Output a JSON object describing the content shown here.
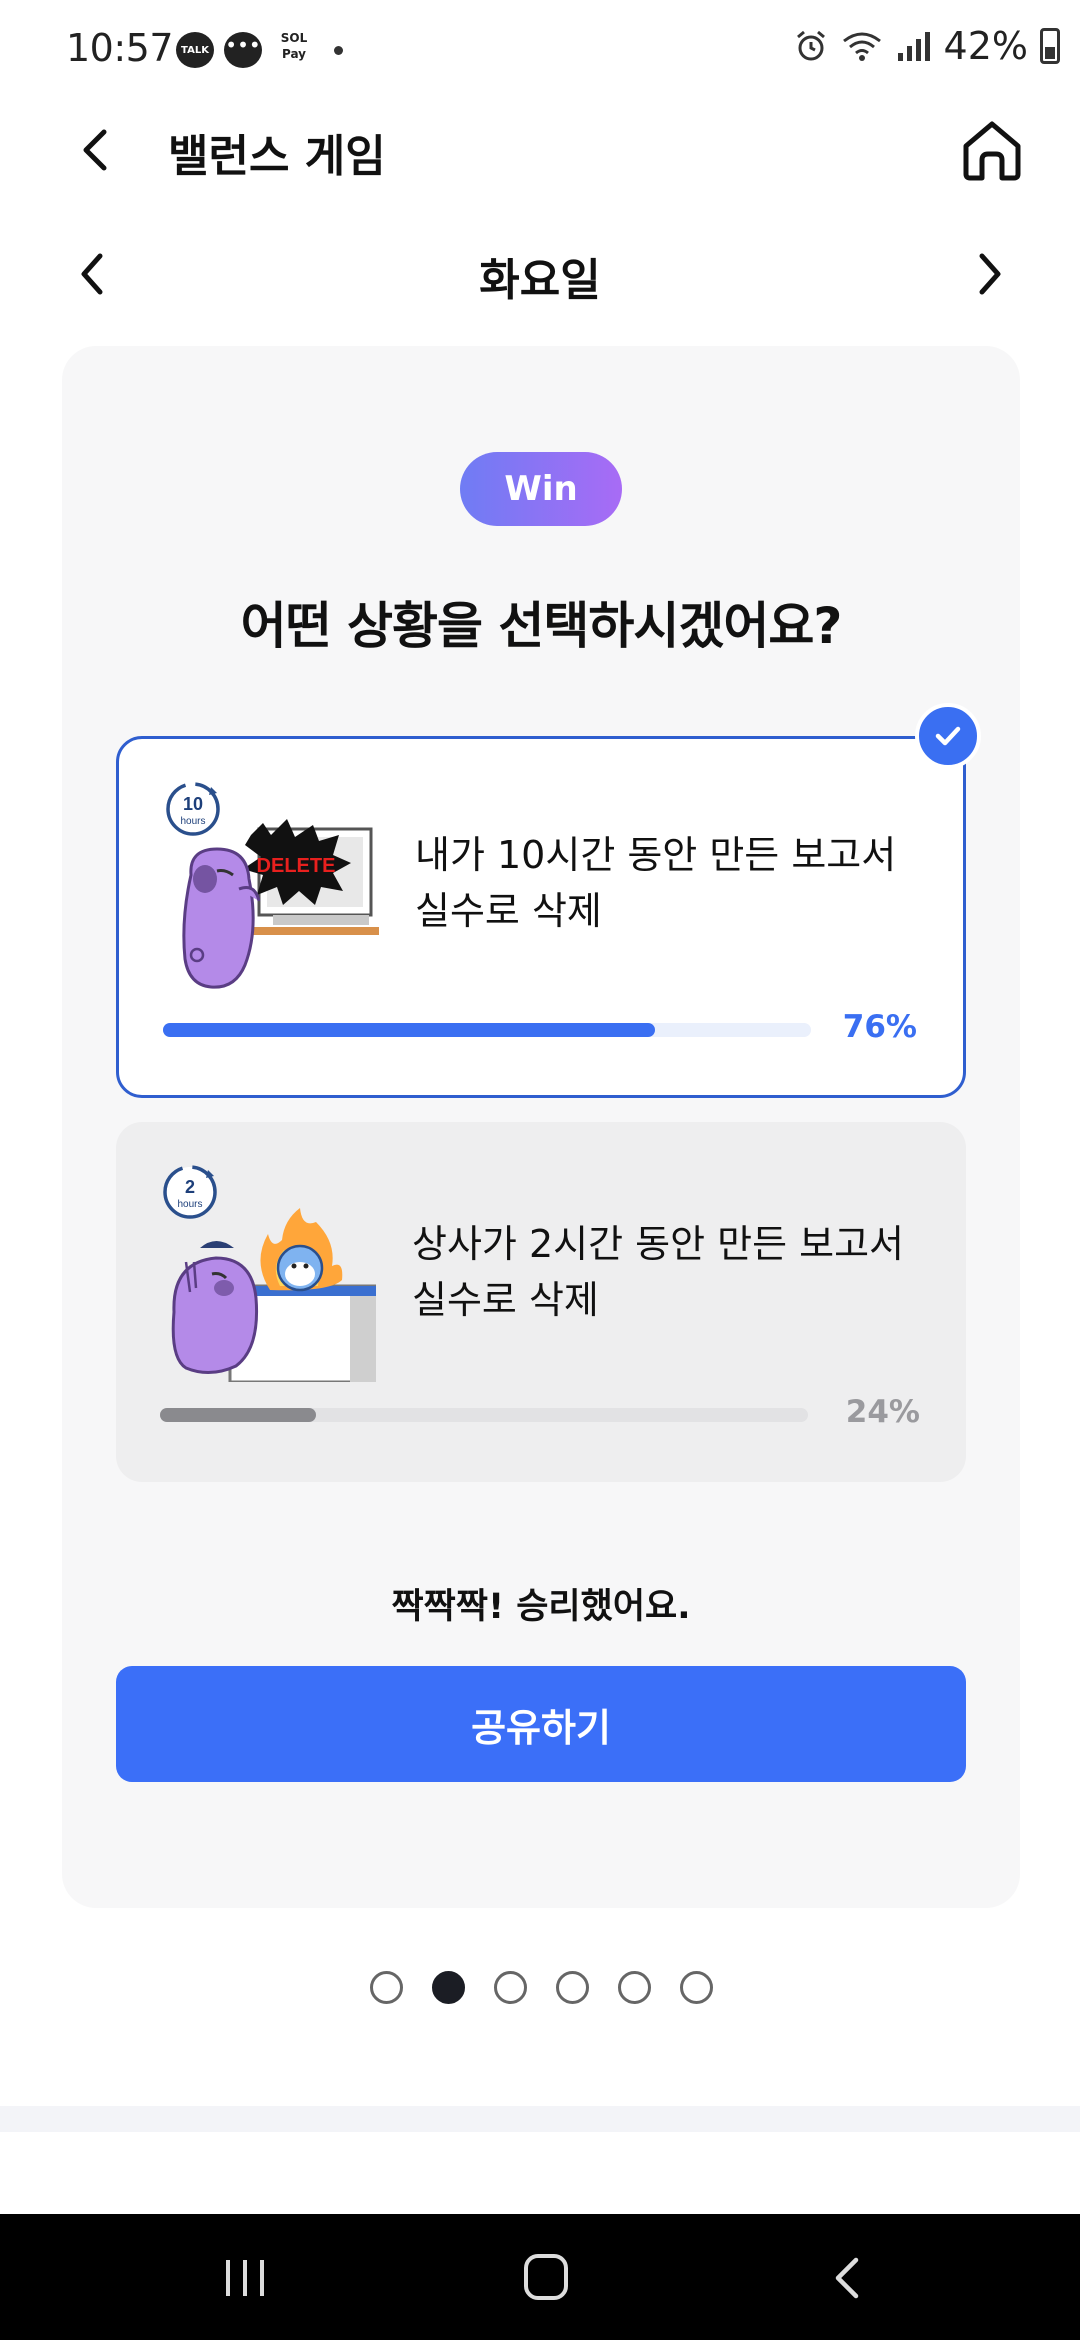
{
  "status_bar": {
    "time": "10:57",
    "notif_talk": "TALK",
    "notif_dots": "•••",
    "notif_sol_line1": "SOL",
    "notif_sol_line2": "Pay",
    "battery": "42%"
  },
  "header": {
    "title": "밸런스 게임"
  },
  "day_nav": {
    "title": "화요일"
  },
  "card": {
    "badge": "Win",
    "question": "어떤 상황을 선택하시겠어요?",
    "options": [
      {
        "line1": "내가 10시간 동안 만든 보고서",
        "line2": "실수로 삭제",
        "percent_label": "76%",
        "percent": 76,
        "selected": true,
        "clock_number": "10",
        "clock_unit": "hours",
        "monitor_text": "DELETE"
      },
      {
        "line1": "상사가 2시간 동안 만든 보고서",
        "line2": "실수로 삭제",
        "percent_label": "24%",
        "percent": 24,
        "selected": false,
        "clock_number": "2",
        "clock_unit": "hours"
      }
    ],
    "result_text": "짝짝짝! 승리했어요.",
    "share_button": "공유하기"
  },
  "pagination": {
    "total": 6,
    "active_index": 1
  },
  "colors": {
    "accent": "#3b6ff8",
    "badge_gradient_start": "#6f7cf4",
    "badge_gradient_end": "#a86bf5",
    "muted_bar": "#8a8a8e",
    "character_purple": "#b48ae8"
  }
}
